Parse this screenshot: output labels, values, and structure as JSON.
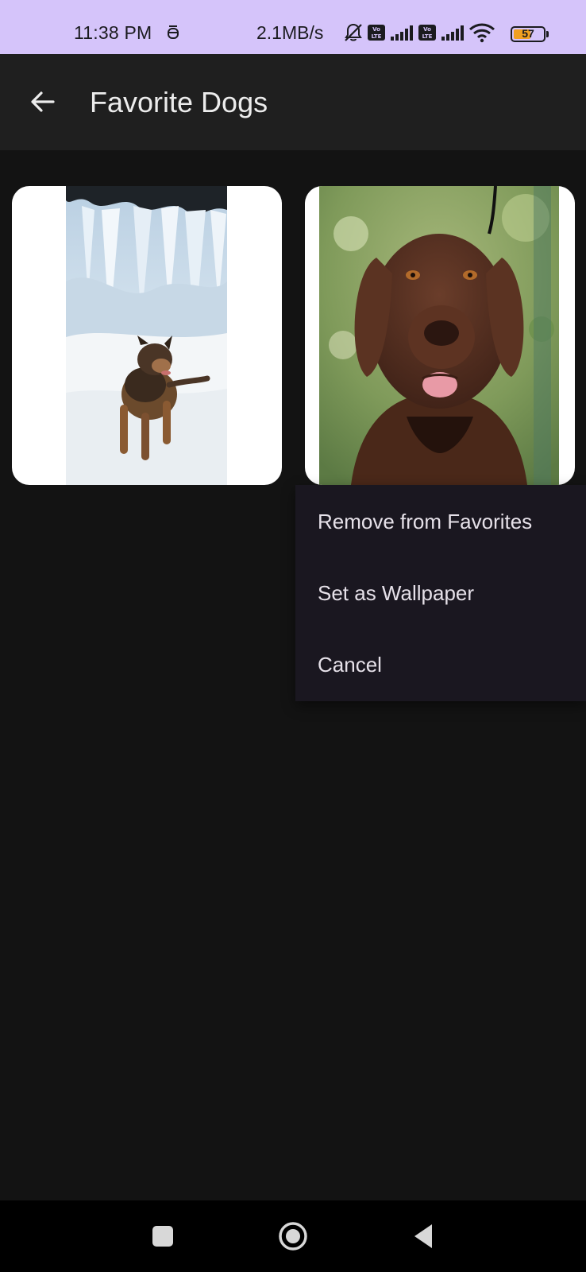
{
  "status_bar": {
    "time": "11:38 PM",
    "network_speed": "2.1MB/s",
    "battery_level": "57",
    "battery_fraction": 0.57,
    "background_color": "#d5c4fa",
    "icons": [
      "notification-icon",
      "mute-icon",
      "volte-icon",
      "signal-icon",
      "volte-icon",
      "signal-icon",
      "wifi-icon",
      "battery-icon"
    ]
  },
  "app_bar": {
    "title": "Favorite Dogs",
    "back_icon": "arrow-left-icon",
    "background_color": "#1f1f1f"
  },
  "favorites": [
    {
      "photo": "dog-in-snow-photo"
    },
    {
      "photo": "brown-dog-portrait-photo"
    }
  ],
  "context_menu": {
    "items": [
      {
        "label": "Remove from Favorites"
      },
      {
        "label": "Set as Wallpaper"
      },
      {
        "label": "Cancel"
      }
    ]
  },
  "nav_bar": {
    "buttons": [
      "recent-apps-icon",
      "home-icon",
      "back-icon"
    ]
  }
}
